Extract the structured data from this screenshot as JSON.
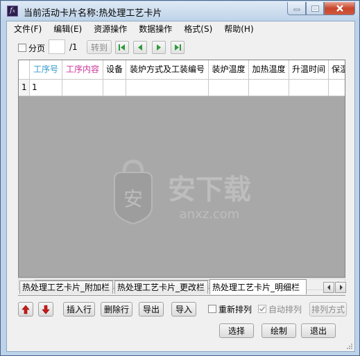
{
  "window": {
    "title": "当前活动卡片名称:热处理工艺卡片"
  },
  "menu": {
    "items": [
      {
        "label": "文件(F)"
      },
      {
        "label": "编辑(E)"
      },
      {
        "label": "资源操作"
      },
      {
        "label": "数据操作"
      },
      {
        "label": "格式(S)"
      },
      {
        "label": "帮助(H)"
      }
    ]
  },
  "toolbar": {
    "paging_label": "分页",
    "page_total": "/1",
    "goto_label": "转到",
    "page_value": ""
  },
  "grid": {
    "columns": [
      "工序号",
      "工序内容",
      "设备",
      "装炉方式及工装编号",
      "装炉温度",
      "加热温度",
      "升温时间",
      "保温"
    ],
    "column_colors": [
      "#3399cc",
      "#cc3399",
      "#000000",
      "#000000",
      "#000000",
      "#000000",
      "#000000",
      "#000000"
    ],
    "rows": [
      {
        "row_header": "1",
        "cells": [
          "1",
          "",
          "",
          "",
          "",
          "",
          "",
          ""
        ]
      }
    ],
    "watermark_text": "安下载",
    "watermark_sub": "anxz.com"
  },
  "tabs": {
    "items": [
      {
        "label": "热处理工艺卡片_附加栏"
      },
      {
        "label": "热处理工艺卡片_更改栏"
      },
      {
        "label": "热处理工艺卡片_明细栏"
      }
    ],
    "active_index": 2
  },
  "actions": {
    "move_up_icon": "red-up-arrow-icon",
    "move_down_icon": "red-down-arrow-icon",
    "insert_row": "插入行",
    "delete_row": "删除行",
    "export": "导出",
    "import": "导入",
    "rearrange": "重新排列",
    "auto_arrange": "自动排列",
    "arrange_mode": "排列方式"
  },
  "footer": {
    "select": "选择",
    "draw": "绘制",
    "exit": "退出"
  }
}
